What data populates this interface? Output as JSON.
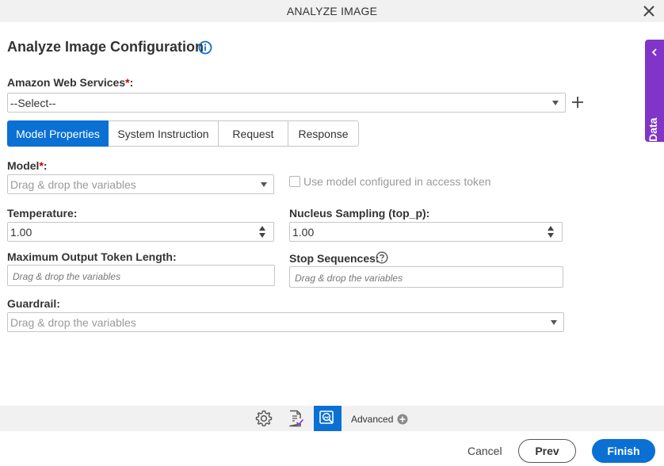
{
  "window": {
    "title": "ANALYZE IMAGE"
  },
  "header": {
    "title": "Analyze Image Configuration"
  },
  "side_tab": {
    "label": "App Data"
  },
  "aws": {
    "label": "Amazon Web Services",
    "required_mark": "*",
    "suffix": ":",
    "value": "--Select--"
  },
  "tabs": [
    {
      "label": "Model Properties",
      "active": true
    },
    {
      "label": "System Instruction",
      "active": false
    },
    {
      "label": "Request",
      "active": false
    },
    {
      "label": "Response",
      "active": false
    }
  ],
  "model": {
    "label": "Model",
    "required_mark": "*",
    "suffix": ":",
    "placeholder": "Drag & drop the variables"
  },
  "use_model_checkbox": {
    "label": "Use model configured in access token",
    "checked": false
  },
  "temperature": {
    "label": "Temperature:",
    "value": "1.00"
  },
  "top_p": {
    "label": "Nucleus Sampling (top_p):",
    "value": "1.00"
  },
  "max_tokens": {
    "label": "Maximum Output Token Length:",
    "placeholder": "Drag & drop the variables"
  },
  "stop_sequences": {
    "label": "Stop Sequences:",
    "placeholder": "Drag & drop the variables"
  },
  "guardrail": {
    "label": "Guardrail:",
    "placeholder": "Drag & drop the variables"
  },
  "toolbar": {
    "advanced_label": "Advanced"
  },
  "footer": {
    "cancel": "Cancel",
    "prev": "Prev",
    "finish": "Finish"
  },
  "colors": {
    "primary": "#0a70d4",
    "side_tab": "#8034c8",
    "required": "#c80000",
    "bar_bg": "#f1f1f1"
  }
}
